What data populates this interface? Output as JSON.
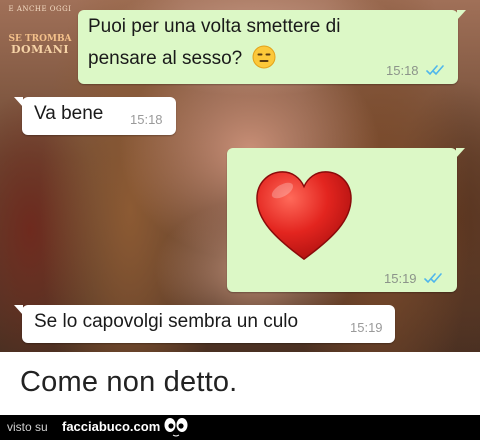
{
  "watermark": {
    "line1": "E ANCHE OGGI",
    "line2": "SE TROMBA",
    "line3": "DOMANI"
  },
  "messages": [
    {
      "direction": "out",
      "line1": "Puoi per una volta smettere di",
      "line2": "pensare al sesso?",
      "emoji": "expressionless-face-emoji",
      "time": "15:18",
      "read_ticks": "double-blue-check"
    },
    {
      "direction": "in",
      "text": "Va bene",
      "time": "15:18"
    },
    {
      "direction": "out",
      "emoji": "red-heart-emoji",
      "time": "15:19",
      "read_ticks": "double-blue-check"
    },
    {
      "direction": "in",
      "text": "Se lo capovolgi sembra un culo",
      "time": "15:19"
    }
  ],
  "caption": "Come non detto.",
  "footer": {
    "visto_su": "visto su",
    "site": "facciabuco.com"
  },
  "colors": {
    "outgoing_bubble": "#dcf8c6",
    "incoming_bubble": "#ffffff",
    "read_ticks": "#4fb6ec",
    "heart": "#e0201f"
  }
}
